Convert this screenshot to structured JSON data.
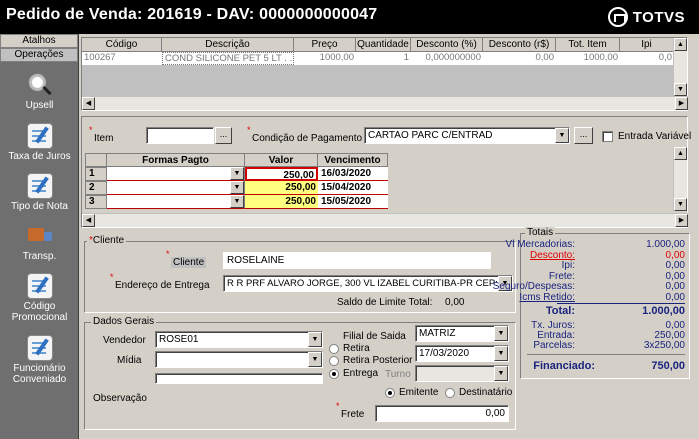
{
  "window": {
    "title": "Pedido de Venda: 201619  - DAV: 0000000000047",
    "brand": "TOTVS"
  },
  "sidebar": {
    "tabs": [
      "Atalhos",
      "Operações"
    ],
    "items": [
      {
        "label": "Upsell",
        "icon": "magnifier-icon"
      },
      {
        "label": "Taxa de Juros",
        "icon": "document-pen-icon"
      },
      {
        "label": "Tipo de Nota",
        "icon": "document-pen-icon"
      },
      {
        "label": "Transp.",
        "icon": "truck-icon"
      },
      {
        "label": "Código Promocional",
        "icon": "document-pen-icon"
      },
      {
        "label": "Funcionário Conveniado",
        "icon": "document-pen-icon"
      }
    ]
  },
  "items_grid": {
    "columns": [
      "Código",
      "Descrição",
      "Preço",
      "Quantidade",
      "Desconto (%)",
      "Desconto (r$)",
      "Tot. Item",
      "Ipi"
    ],
    "rows": [
      [
        "100267",
        "COND SILICONE PET 5 LT  . . .",
        "1000,00",
        "1",
        "0,000000000",
        "0,00",
        "1000,00",
        "0,0"
      ]
    ]
  },
  "payment": {
    "item_label": "Item",
    "item_button": "...",
    "condition_label": "Condição de Pagamento",
    "condition_value": "CARTAO PARC C/ENTRAD",
    "condition_button": "...",
    "variable_entry_label": "Entrada Variável",
    "table": {
      "headers": [
        "Formas Pagto",
        "Valor",
        "Vencimento"
      ],
      "rows": [
        {
          "n": "1",
          "forma": "",
          "valor": "250,00",
          "vencimento": "16/03/2020"
        },
        {
          "n": "2",
          "forma": "",
          "valor": "250,00",
          "vencimento": "15/04/2020"
        },
        {
          "n": "3",
          "forma": "",
          "valor": "250,00",
          "vencimento": "15/05/2020"
        }
      ]
    }
  },
  "cliente": {
    "group_title": "Cliente",
    "cliente_label": "Cliente",
    "cliente_value": "ROSELAINE",
    "endereco_label": "Endereço de Entrega",
    "endereco_value": "R  R PRF ALVARO JORGE, 300  VL IZABEL CURITIBA-PR CEP:",
    "saldo_label": "Saldo de Limite Total:",
    "saldo_value": "0,00"
  },
  "dados_gerais": {
    "group_title": "Dados Gerais",
    "vendedor_label": "Vendedor",
    "vendedor_value": "ROSE01",
    "midia_label": "Mídia",
    "midia_value": "",
    "observacao_label": "Observação",
    "filial_label": "Filial de Saida",
    "filial_value": "MATRIZ",
    "radio_retira": "Retira",
    "radio_retira_posterior": "Retira Posterior",
    "radio_entrega": "Entrega",
    "entrega_date": "17/03/2020",
    "turno_label": "Turno",
    "radio_emitente": "Emitente",
    "radio_destinatario": "Destinatário",
    "frete_label": "Frete",
    "frete_value": "0,00"
  },
  "totais": {
    "group_title": "Totais",
    "lines": [
      {
        "label": "Vl Mercadorias:",
        "value": "1.000,00",
        "style": "normal"
      },
      {
        "label": "Desconto:",
        "value": "0,00",
        "style": "red"
      },
      {
        "label": "Ipi:",
        "value": "0,00",
        "style": "normal"
      },
      {
        "label": "Frete:",
        "value": "0,00",
        "style": "normal"
      },
      {
        "label": "Seguro/Despesas:",
        "value": "0,00",
        "style": "normal"
      },
      {
        "label": "Icms Retido:",
        "value": "0,00",
        "style": "underline"
      }
    ],
    "total_label": "Total:",
    "total_value": "1.000,00",
    "juros_label": "Tx. Juros:",
    "juros_value": "0,00",
    "entrada_label": "Entrada:",
    "entrada_value": "250,00",
    "parcelas_label": "Parcelas:",
    "parcelas_value": "3x250,00",
    "financiado_label": "Financiado:",
    "financiado_value": "750,00",
    "colors": {
      "text": "#1a237e",
      "desconto": "#e00000"
    }
  }
}
